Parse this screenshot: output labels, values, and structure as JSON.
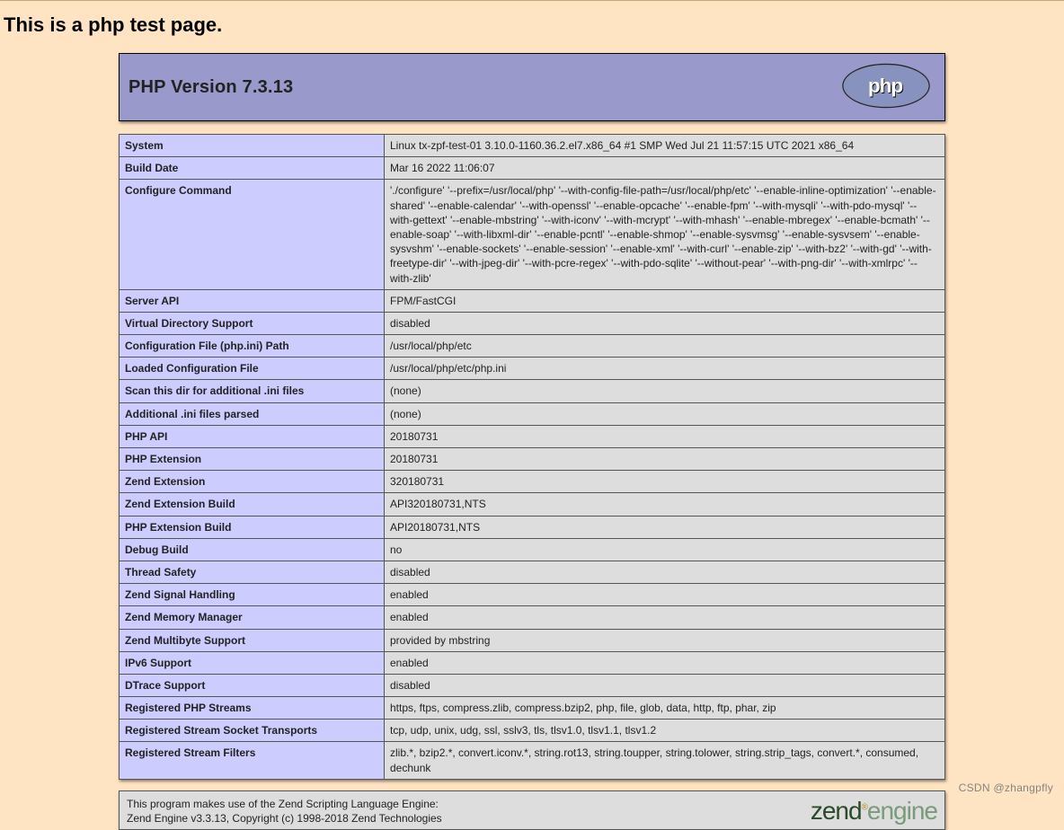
{
  "heading": "This is a php test page.",
  "version_title": "PHP Version 7.3.13",
  "rows": [
    {
      "k": "System",
      "v": "Linux tx-zpf-test-01 3.10.0-1160.36.2.el7.x86_64 #1 SMP Wed Jul 21 11:57:15 UTC 2021 x86_64"
    },
    {
      "k": "Build Date",
      "v": "Mar 16 2022 11:06:07"
    },
    {
      "k": "Configure Command",
      "v": "'./configure' '--prefix=/usr/local/php' '--with-config-file-path=/usr/local/php/etc' '--enable-inline-optimization' '--enable-shared' '--enable-calendar' '--with-openssl' '--enable-opcache' '--enable-fpm' '--with-mysqli' '--with-pdo-mysql' '--with-gettext' '--enable-mbstring' '--with-iconv' '--with-mcrypt' '--with-mhash' '--enable-mbregex' '--enable-bcmath' '--enable-soap' '--with-libxml-dir' '--enable-pcntl' '--enable-shmop' '--enable-sysvmsg' '--enable-sysvsem' '--enable-sysvshm' '--enable-sockets' '--enable-session' '--enable-xml' '--with-curl' '--enable-zip' '--with-bz2' '--with-gd' '--with-freetype-dir' '--with-jpeg-dir' '--with-pcre-regex' '--with-pdo-sqlite' '--without-pear' '--with-png-dir' '--with-xmlrpc' '--with-zlib'"
    },
    {
      "k": "Server API",
      "v": "FPM/FastCGI"
    },
    {
      "k": "Virtual Directory Support",
      "v": "disabled"
    },
    {
      "k": "Configuration File (php.ini) Path",
      "v": "/usr/local/php/etc"
    },
    {
      "k": "Loaded Configuration File",
      "v": "/usr/local/php/etc/php.ini"
    },
    {
      "k": "Scan this dir for additional .ini files",
      "v": "(none)"
    },
    {
      "k": "Additional .ini files parsed",
      "v": "(none)"
    },
    {
      "k": "PHP API",
      "v": "20180731"
    },
    {
      "k": "PHP Extension",
      "v": "20180731"
    },
    {
      "k": "Zend Extension",
      "v": "320180731"
    },
    {
      "k": "Zend Extension Build",
      "v": "API320180731,NTS"
    },
    {
      "k": "PHP Extension Build",
      "v": "API20180731,NTS"
    },
    {
      "k": "Debug Build",
      "v": "no"
    },
    {
      "k": "Thread Safety",
      "v": "disabled"
    },
    {
      "k": "Zend Signal Handling",
      "v": "enabled"
    },
    {
      "k": "Zend Memory Manager",
      "v": "enabled"
    },
    {
      "k": "Zend Multibyte Support",
      "v": "provided by mbstring"
    },
    {
      "k": "IPv6 Support",
      "v": "enabled"
    },
    {
      "k": "DTrace Support",
      "v": "disabled"
    },
    {
      "k": "Registered PHP Streams",
      "v": "https, ftps, compress.zlib, compress.bzip2, php, file, glob, data, http, ftp, phar, zip"
    },
    {
      "k": "Registered Stream Socket Transports",
      "v": "tcp, udp, unix, udg, ssl, sslv3, tls, tlsv1.0, tlsv1.1, tlsv1.2"
    },
    {
      "k": "Registered Stream Filters",
      "v": "zlib.*, bzip2.*, convert.iconv.*, string.rot13, string.toupper, string.tolower, string.strip_tags, convert.*, consumed, dechunk"
    }
  ],
  "footer_line1": "This program makes use of the Zend Scripting Language Engine:",
  "footer_line2": "Zend Engine v3.3.13, Copyright (c) 1998-2018 Zend Technologies",
  "zend_logo_main": "zend",
  "zend_logo_sub": "engine",
  "watermark": "CSDN @zhangpfly"
}
